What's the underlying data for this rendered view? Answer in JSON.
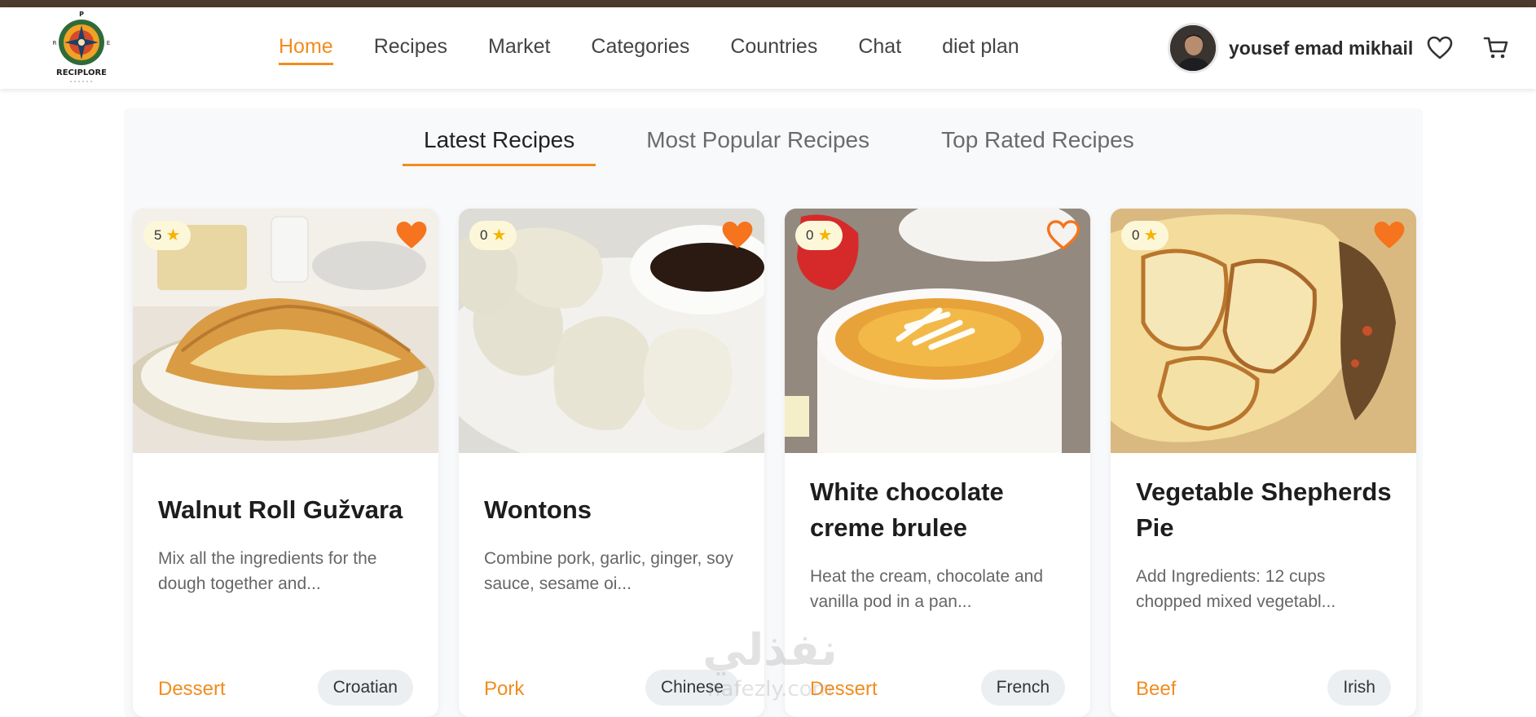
{
  "brand": {
    "logo_text": "RECIPLORE",
    "accent_color": "#f28c1e"
  },
  "nav": {
    "items": [
      {
        "label": "Home",
        "active": true
      },
      {
        "label": "Recipes",
        "active": false
      },
      {
        "label": "Market",
        "active": false
      },
      {
        "label": "Categories",
        "active": false
      },
      {
        "label": "Countries",
        "active": false
      },
      {
        "label": "Chat",
        "active": false
      },
      {
        "label": "diet plan",
        "active": false
      }
    ]
  },
  "user": {
    "name": "yousef emad mikhail",
    "avatar_icon": "user-avatar"
  },
  "header_icons": {
    "wishlist": "heart-icon",
    "cart": "cart-icon"
  },
  "tabs": [
    {
      "label": "Latest Recipes",
      "active": true
    },
    {
      "label": "Most Popular Recipes",
      "active": false
    },
    {
      "label": "Top Rated Recipes",
      "active": false
    }
  ],
  "recipes": [
    {
      "title": "Walnut Roll Gužvara",
      "rating": "5",
      "favorited": true,
      "description": "Mix all the ingredients for the dough together and...",
      "category": "Dessert",
      "country": "Croatian"
    },
    {
      "title": "Wontons",
      "rating": "0",
      "favorited": true,
      "description": "Combine pork, garlic, ginger, soy sauce, sesame oi...",
      "category": "Pork",
      "country": "Chinese"
    },
    {
      "title": "White chocolate creme brulee",
      "rating": "0",
      "favorited": false,
      "description": "Heat the cream, chocolate and vanilla pod in a pan...",
      "category": "Dessert",
      "country": "French"
    },
    {
      "title": "Vegetable Shepherds Pie",
      "rating": "0",
      "favorited": true,
      "description": "Add Ingredients: 12 cups chopped mixed vegetabl...",
      "category": "Beef",
      "country": "Irish"
    }
  ],
  "watermark": {
    "line1": "نفذلي",
    "line2": "nafezly.com"
  }
}
